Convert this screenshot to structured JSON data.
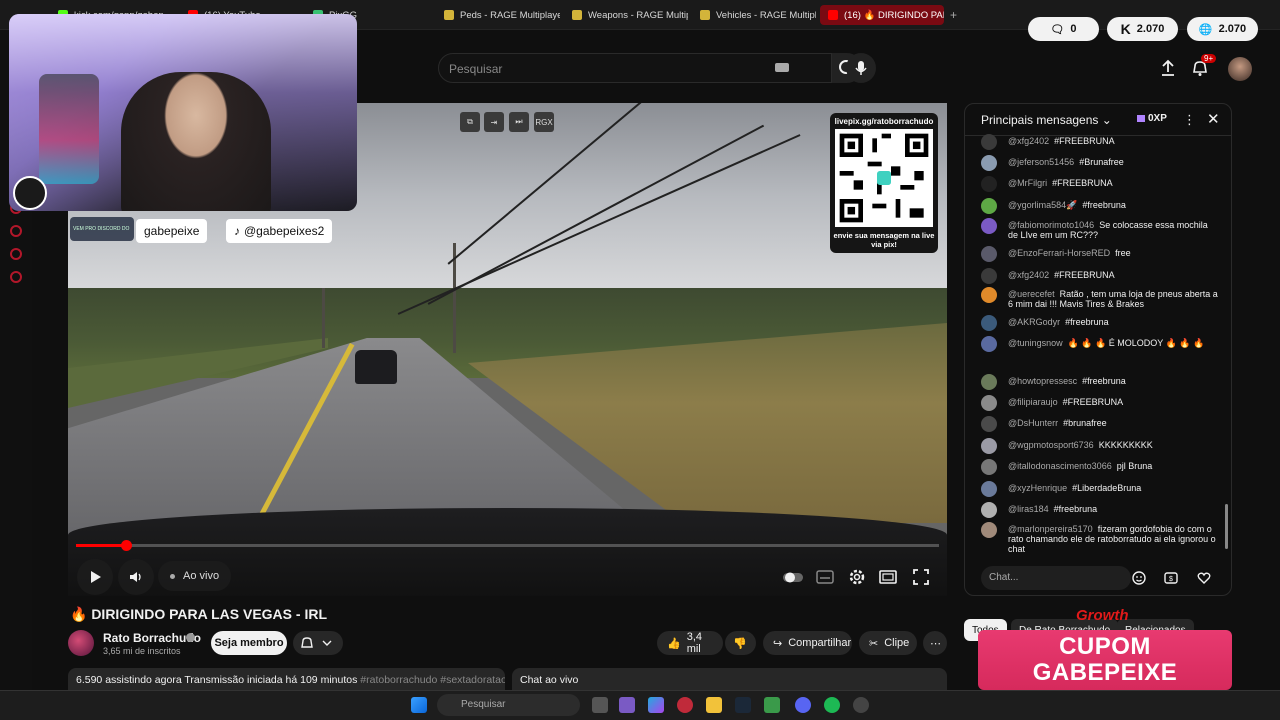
{
  "browser": {
    "tabs": [
      {
        "label": "kick.com/gapp/gabep...",
        "color": "#53fc18"
      },
      {
        "label": "(16) YouTube",
        "color": "#ff0000"
      },
      {
        "label": "PixGG",
        "color": "#38c172"
      },
      {
        "label": "Peds - RAGE Multiplayer",
        "color": "#d3b43a"
      },
      {
        "label": "Weapons - RAGE Multipla",
        "color": "#d3b43a"
      },
      {
        "label": "Vehicles - RAGE Multiplay",
        "color": "#d3b43a"
      },
      {
        "label": "(16) 🔥 DIRIGINDO PARA",
        "color": "#ff0000"
      }
    ],
    "new_tab": "+"
  },
  "header": {
    "search_placeholder": "Pesquisar",
    "notif_count": "9+",
    "pills": [
      {
        "label": "0",
        "icon": "comment-icon"
      },
      {
        "label": "2.070",
        "icon": "kick-icon"
      },
      {
        "label": "2.070",
        "icon": "globe-icon"
      }
    ]
  },
  "video": {
    "overlay_handle_1": "gabepeixe",
    "overlay_handle_2": "@gabepeixes2",
    "discord_tag": "VEM PRO DISCORD DO",
    "qr_url": "livepix.gg/ratoborrachudo",
    "qr_caption": "envie sua mensagem na live via pix!",
    "live_label": "Ao vivo",
    "tool_label": "RGX",
    "progress": 0.058
  },
  "info": {
    "title": "🔥 DIRIGINDO PARA LAS VEGAS - IRL",
    "channel": "Rato Borrachudo",
    "subscribers": "3,65 mi de inscritos",
    "member_button": "Seja membro",
    "likes": "3,4 mil",
    "share": "Compartilhar",
    "clip": "Clipe",
    "description": "6.590 assistindo agora  Transmissão iniciada há 109 minutos",
    "description_tags": "#ratoborrachudo #sextadoratao #live",
    "chat_toggle": "Chat ao vivo"
  },
  "chat": {
    "title": "Principais mensagens",
    "xp": "0XP",
    "input_placeholder": "Chat...",
    "messages": [
      {
        "author": "@xfg2402",
        "text": "#FREEBRUNA",
        "color": "#3a3a3a"
      },
      {
        "author": "@jeferson51456",
        "text": "#Brunafree",
        "color": "#8a9bb0"
      },
      {
        "author": "@MrFilgri",
        "text": "#FREEBRUNA",
        "color": "#222222"
      },
      {
        "author": "@ygorlima584🚀",
        "text": "#freebruna",
        "color": "#5ea845"
      },
      {
        "author": "@fabiomorimoto1046",
        "text": "Se colocasse essa mochila de LIve em um RC???",
        "color": "#7a5ac4"
      },
      {
        "author": "@EnzoFerrari-HorseRED",
        "text": "free",
        "color": "#5a5a6a"
      },
      {
        "author": "@xfg2402",
        "text": "#FREEBRUNA",
        "color": "#3a3a3a"
      },
      {
        "author": "@uerecefet",
        "text": "Ratão , tem uma loja de pneus aberta a 6 mim dai !!! Mavis Tires & Brakes",
        "color": "#e08a2a"
      },
      {
        "author": "@AKRGodyr",
        "text": "#freebruna",
        "color": "#3b5a7a"
      },
      {
        "author": "@tuningsnow",
        "text": "🔥 🔥 🔥 É MOLODOY 🔥 🔥 🔥",
        "color": "#5a6aa0"
      },
      {
        "author": "@howtopressesc",
        "text": "#freebruna",
        "color": "#6a7a5a"
      },
      {
        "author": "@filipiaraujo",
        "text": "#FREEBRUNA",
        "color": "#8a8a8a"
      },
      {
        "author": "@DsHunterr",
        "text": "#brunafree",
        "color": "#4a4a4a"
      },
      {
        "author": "@wgpmotosport6736",
        "text": "KKKKKKKKK",
        "color": "#9a9aa5"
      },
      {
        "author": "@itallodonascimento3066",
        "text": "pjl Bruna",
        "color": "#777777"
      },
      {
        "author": "@xyzHenrique",
        "text": "#LiberdadeBruna",
        "color": "#6a7a9a"
      },
      {
        "author": "@liras184",
        "text": "#freebruna",
        "color": "#b0b0b0"
      },
      {
        "author": "@marlonpereira5170",
        "text": "fizeram gordofobia do com o rato chamando ele de ratoborratudo ai ela ignorou o chat",
        "color": "#a08a7a"
      }
    ]
  },
  "chips": [
    "Todos",
    "De Rato Borrachudo",
    "Relacionados"
  ],
  "ad": {
    "brand": "Growth",
    "line1": "CUPOM",
    "line2": "GABEPEIXE"
  },
  "taskbar": {
    "search_placeholder": "Pesquisar"
  }
}
